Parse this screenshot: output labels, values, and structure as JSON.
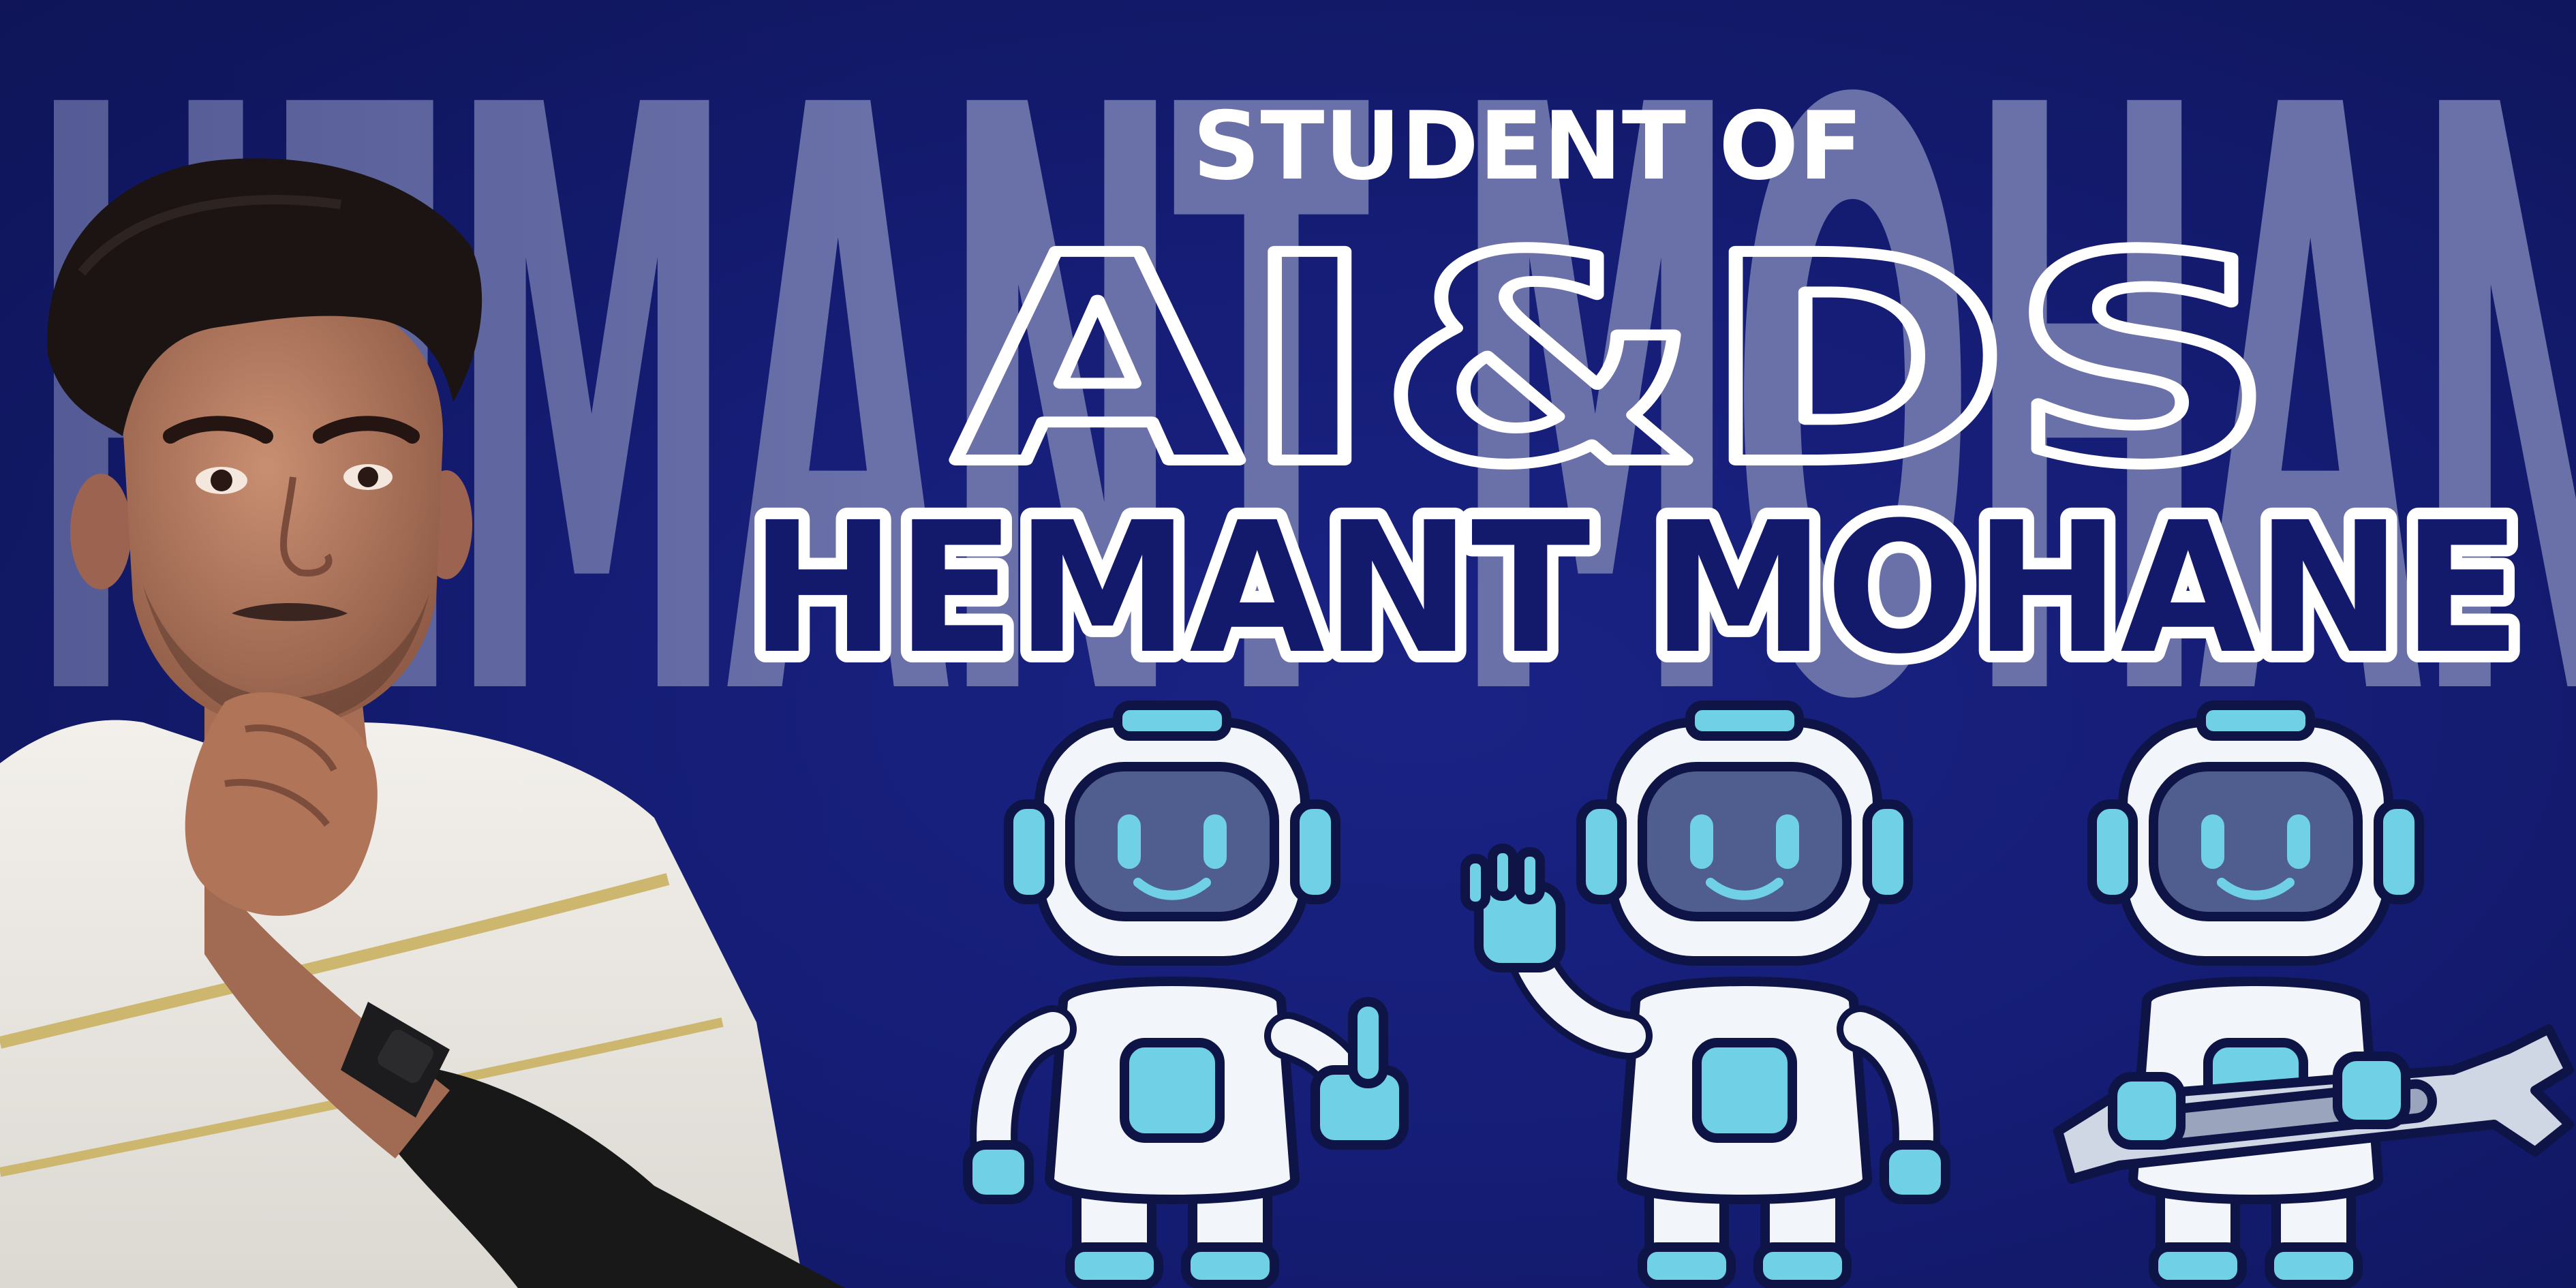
{
  "background_name": "HEMANT MOHANE",
  "headline": {
    "label": "STUDENT OF",
    "subject": "AI&DS",
    "name": "HEMANT MOHANE"
  },
  "colors": {
    "background": "#131a6b",
    "background_text": "#6a70a8",
    "name_fill": "#131a6b",
    "outline": "#ffffff",
    "robot_visor": "#4f5e8f",
    "robot_accent": "#6fd0e6",
    "robot_body": "#f2f6fb"
  },
  "illustrations": {
    "portrait": "person-portrait",
    "robots": [
      "robot-thumbs-up-icon",
      "robot-waving-icon",
      "robot-wrench-icon"
    ]
  }
}
